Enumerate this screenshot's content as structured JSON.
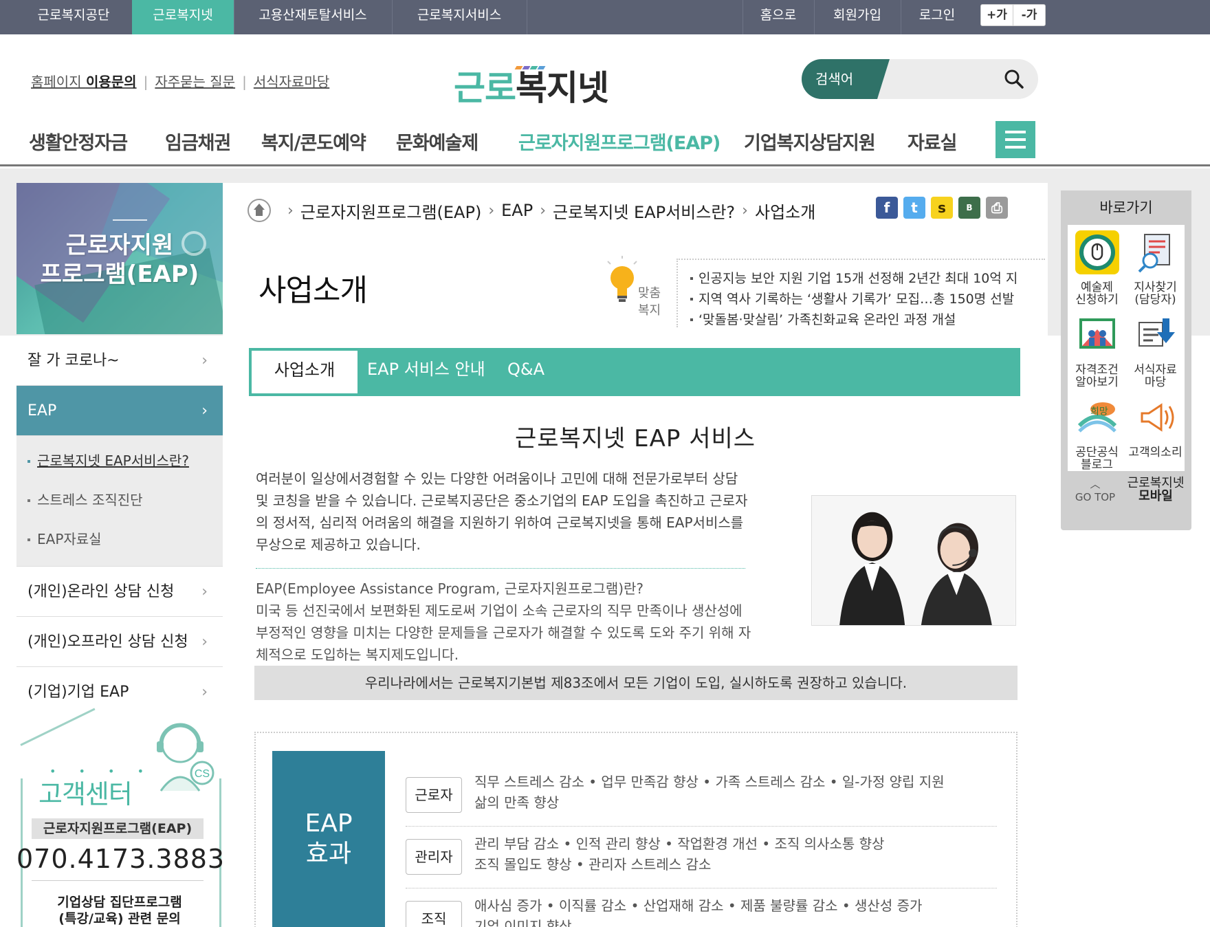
{
  "topbar": {
    "sites": [
      "근로복지공단",
      "근로복지넷",
      "고용산재토탈서비스",
      "근로복지서비스"
    ],
    "right": [
      "홈으로",
      "회원가입",
      "로그인"
    ],
    "font_plus": "+가",
    "font_minus": "-가"
  },
  "header": {
    "util_links": [
      {
        "pre": "홈페이지 ",
        "bold": "이용문의"
      },
      {
        "pre": "자주묻는 질문",
        "bold": ""
      },
      {
        "pre": "서식자료마당",
        "bold": ""
      }
    ],
    "logo_green": "근로",
    "logo_dark": "복지넷",
    "search_label": "검색어",
    "search_placeholder": ""
  },
  "gnb": [
    "생활안정자금",
    "임금채권",
    "복지/콘도예약",
    "문화예술제",
    "근로자지원프로그램(EAP)",
    "기업복지상담지원",
    "자료실"
  ],
  "sidebar": {
    "banner_title_1": "근로자지원",
    "banner_title_2": "프로그램(EAP)",
    "items": [
      {
        "label": "잘 가 코로나~"
      },
      {
        "label": "EAP"
      }
    ],
    "sub_items": [
      "근로복지넷 EAP서비스란?",
      "스트레스 조직진단",
      "EAP자료실"
    ],
    "items_after": [
      {
        "label": "(개인)온라인 상담 신청"
      },
      {
        "label": "(개인)오프라인 상담 신청"
      },
      {
        "label": "(기업)기업 EAP"
      }
    ],
    "arrow": "›",
    "cs": {
      "title": "고객센터",
      "dots": "• • • •",
      "program": "근로자지원프로그램(EAP)",
      "phone": "070.4173.3883",
      "note_1": "기업상담 집단프로그램",
      "note_2": "(특강/교육) 관련 문의"
    }
  },
  "breadcrumb": [
    "근로자지원프로그램(EAP)",
    "EAP",
    "근로복지넷 EAP서비스란?",
    "사업소개"
  ],
  "breadcrumb_sep": "›",
  "sns": [
    {
      "name": "facebook",
      "glyph": "f",
      "color": "#3b5998"
    },
    {
      "name": "twitter",
      "glyph": "t",
      "color": "#55acee"
    },
    {
      "name": "kakaostory",
      "glyph": "s",
      "color": "#f7d21e"
    },
    {
      "name": "band",
      "glyph": "B",
      "color": "#3d6e4a"
    },
    {
      "name": "print",
      "glyph": "⎙",
      "color": "#9a9a9a"
    }
  ],
  "page_title": "사업소개",
  "matchum_1": "맞춤",
  "matchum_2": "복지",
  "news": [
    "인공지능 보안 지원 기업 15개 선정해 2년간 최대 10억 지",
    "지역 역사 기록하는 ‘생활사 기록가’ 모집…총 150명 선발",
    "‘맞돌봄·맞살림’ 가족친화교육 온라인 과정 개설"
  ],
  "tabs": [
    "사업소개",
    "EAP 서비스 안내",
    "Q&A"
  ],
  "section_title": "근로복지넷 EAP 서비스",
  "intro": "여러분이 일상에서경험할 수 있는 다양한 어려움이나 고민에 대해 전문가로부터 상담 및 코칭을 받을 수 있습니다. 근로복지공단은 중소기업의 EAP 도입을 촉진하고 근로자의 정서적, 심리적 어려움의 해결을 지원하기 위하여 근로복지넷을 통해 EAP서비스를 무상으로 제공하고 있습니다.",
  "def_title": "EAP(Employee Assistance Program, 근로자지원프로그램)란?",
  "def_body": "미국 등 선진국에서 보편화된 제도로써 기업이 소속 근로자의 직무 만족이나 생산성에 부정적인 영향을 미치는 다양한 문제들을 근로자가 해결할 수 있도록 도와 주기 위해 자체적으로 도입하는 복지제도입니다.",
  "law": "우리나라에서는 근로복지기본법 제83조에서 모든 기업이 도입, 실시하도록 권장하고 있습니다.",
  "effect": {
    "box_1": "EAP",
    "box_2": "효과",
    "rows": [
      {
        "tag": "근로자",
        "line1": "직무 스트레스 감소 • 업무 만족감 향상 • 가족 스트레스 감소 • 일-가정 양립 지원",
        "line2": "삶의 만족 향상"
      },
      {
        "tag": "관리자",
        "line1": "관리 부담 감소 • 인적 관리 향상 • 작업환경 개선 • 조직 의사소통 향상",
        "line2": "조직 몰입도 향상 • 관리자 스트레스 감소"
      },
      {
        "tag": "조직",
        "line1": "애사심 증가 • 이직률 감소 • 산업재해 감소 • 제품 불량률 감소 • 생산성 증가",
        "line2": "기업 이미지 향상"
      }
    ]
  },
  "quick": {
    "title": "바로가기",
    "items": [
      {
        "l1": "예술제",
        "l2": "신청하기",
        "icon": "mouse-click-icon"
      },
      {
        "l1": "지사찾기",
        "l2": "(담당자)",
        "icon": "map-search-icon"
      },
      {
        "l1": "자격조건",
        "l2": "알아보기",
        "icon": "family-icon"
      },
      {
        "l1": "서식자료",
        "l2": "마당",
        "icon": "download-icon"
      },
      {
        "l1": "공단공식",
        "l2": "블로그",
        "icon": "blog-icon"
      },
      {
        "l1": "고객의소리",
        "l2": "",
        "icon": "megaphone-icon"
      }
    ],
    "gotop_arrow": "︿",
    "gotop": "GO TOP",
    "mobile_1": "근로복지넷",
    "mobile_2": "모바일"
  }
}
